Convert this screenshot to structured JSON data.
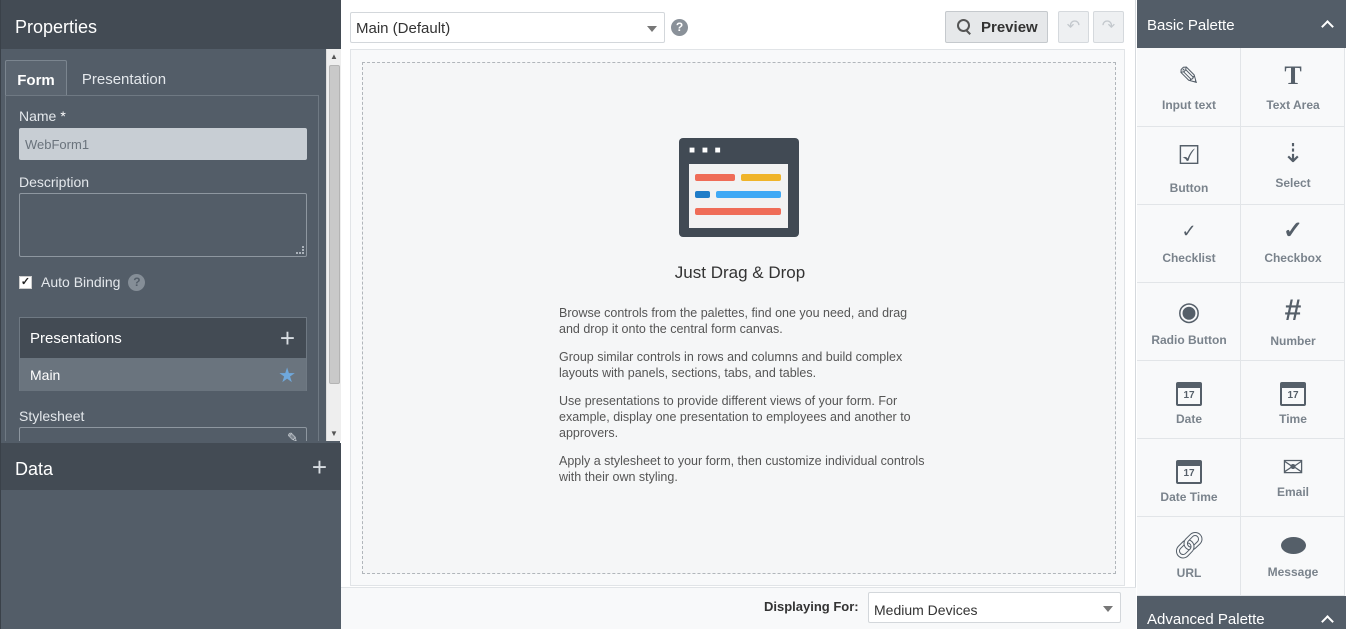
{
  "properties": {
    "title": "Properties",
    "tabs": [
      {
        "label": "Form",
        "active": true
      },
      {
        "label": "Presentation",
        "active": false
      }
    ],
    "name_label": "Name",
    "required_mark": "*",
    "name_value": "WebForm1",
    "description_label": "Description",
    "description_value": "",
    "auto_binding_label": "Auto Binding",
    "auto_binding_checked": true,
    "help_glyph": "?",
    "presentations_label": "Presentations",
    "presentations": [
      "Main"
    ],
    "stylesheet_label": "Stylesheet"
  },
  "data_section": {
    "title": "Data"
  },
  "toolbar": {
    "view_select_value": "Main (Default)",
    "help_glyph": "?",
    "preview_label": "Preview"
  },
  "canvas": {
    "title": "Just Drag & Drop",
    "paragraphs": [
      "Browse controls from the palettes, find one you need, and drag and drop it onto the central form canvas.",
      "Group similar controls in rows and columns and build complex layouts with panels, sections, tabs, and tables.",
      "Use presentations to provide different views of your form. For example, display one presentation to employees and another to approvers.",
      "Apply a stylesheet to your form, then customize individual controls with their own styling."
    ]
  },
  "footer": {
    "displaying_for_label": "Displaying For:",
    "device_value": "Medium Devices"
  },
  "palette": {
    "basic_title": "Basic Palette",
    "advanced_title": "Advanced Palette",
    "items": [
      {
        "label": "Input text",
        "icon": "pencil-icon"
      },
      {
        "label": "Text Area",
        "icon": "text-area-icon"
      },
      {
        "label": "Button",
        "icon": "button-icon"
      },
      {
        "label": "Select",
        "icon": "select-icon"
      },
      {
        "label": "Checklist",
        "icon": "checklist-icon"
      },
      {
        "label": "Checkbox",
        "icon": "checkbox-icon"
      },
      {
        "label": "Radio Button",
        "icon": "radio-button-icon"
      },
      {
        "label": "Number",
        "icon": "number-icon"
      },
      {
        "label": "Date",
        "icon": "calendar-icon"
      },
      {
        "label": "Time",
        "icon": "calendar-icon"
      },
      {
        "label": "Date Time",
        "icon": "calendar-icon"
      },
      {
        "label": "Email",
        "icon": "envelope-icon"
      },
      {
        "label": "URL",
        "icon": "link-icon"
      },
      {
        "label": "Message",
        "icon": "speech-bubble-icon"
      }
    ],
    "calendar_day": "17"
  },
  "colors": {
    "panel_dark": "#434b54",
    "panel": "#535d68",
    "accent_star": "#6fa8dc",
    "bar_red": "#ef6c57",
    "bar_yellow": "#f0b429",
    "bar_blue": "#3fa9f5",
    "bar_darkblue": "#1e7cc8"
  }
}
